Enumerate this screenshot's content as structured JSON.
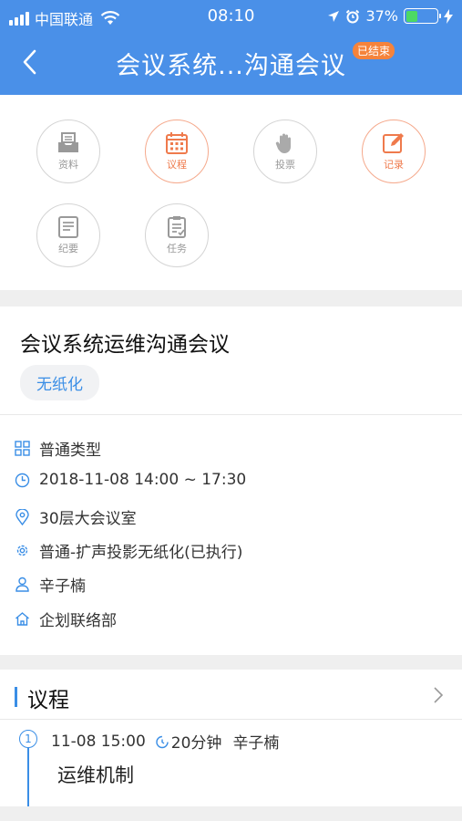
{
  "status_bar": {
    "carrier": "中国联通",
    "time": "08:10",
    "battery": "37%",
    "battery_level": 0.37
  },
  "nav": {
    "title": "会议系统...沟通会议",
    "badge": "已结束",
    "back_icon": "chevron-left-icon"
  },
  "modules": [
    {
      "label": "资料",
      "icon": "document-tray-icon",
      "active": false
    },
    {
      "label": "议程",
      "icon": "calendar-icon",
      "active": true
    },
    {
      "label": "投票",
      "icon": "hand-vote-icon",
      "active": false
    },
    {
      "label": "记录",
      "icon": "edit-icon",
      "active": true
    },
    {
      "label": "纪要",
      "icon": "notes-icon",
      "active": false
    },
    {
      "label": "任务",
      "icon": "task-list-icon",
      "active": false
    }
  ],
  "meeting": {
    "title": "会议系统运维沟通会议",
    "tag": "无纸化",
    "details": [
      {
        "icon": "grid-icon",
        "text": "普通类型"
      },
      {
        "icon": "clock-icon",
        "text": "2018-11-08 14:00 ~ 17:30"
      },
      {
        "icon": "location-icon",
        "text": "30层大会议室"
      },
      {
        "icon": "settings-icon",
        "text": "普通-扩声投影无纸化(已执行)"
      },
      {
        "icon": "person-icon",
        "text": "辛子楠"
      },
      {
        "icon": "home-icon",
        "text": "企划联络部"
      }
    ]
  },
  "agenda": {
    "title": "议程",
    "items": [
      {
        "number": "1",
        "time": "11-08 15:00",
        "duration": "20分钟",
        "presenter": "辛子楠",
        "topic": "运维机制"
      }
    ]
  },
  "colors": {
    "header": "#4a90e8",
    "accent": "#3a8ee6",
    "active": "#ef7a4c",
    "badge": "#f5833b"
  }
}
